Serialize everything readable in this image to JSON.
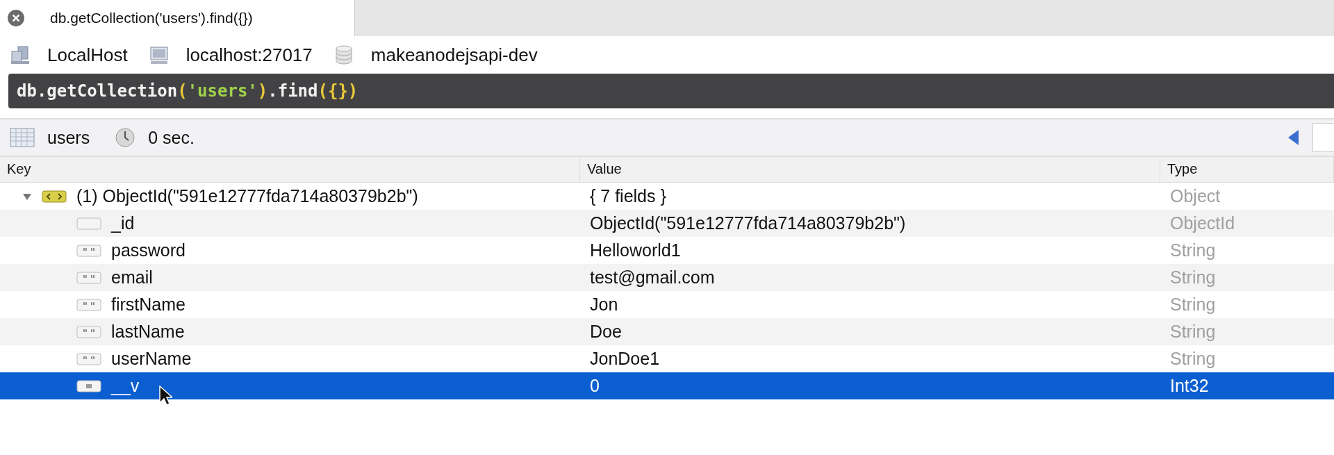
{
  "tab": {
    "title": "db.getCollection('users').find({})",
    "selected": true
  },
  "breadcrumb": [
    {
      "kind": "server",
      "label": "LocalHost"
    },
    {
      "kind": "host",
      "label": "localhost:27017"
    },
    {
      "kind": "database",
      "label": "makeanodejsapi-dev"
    }
  ],
  "query": [
    {
      "kind": "plain",
      "text": "db.getCollection"
    },
    {
      "kind": "paren",
      "text": "("
    },
    {
      "kind": "string",
      "text": "'users'"
    },
    {
      "kind": "paren",
      "text": ")"
    },
    {
      "kind": "plain",
      "text": ".find"
    },
    {
      "kind": "paren",
      "text": "({})"
    }
  ],
  "status": {
    "collection": "users",
    "time": "0 sec."
  },
  "table": {
    "columns": [
      "Key",
      "Value",
      "Type"
    ],
    "rows": [
      {
        "kind": "object",
        "key": "(1) ObjectId(\"591e12777fda714a80379b2b\")",
        "value": "{ 7 fields }",
        "type": "Object",
        "expanded": true,
        "selected": false,
        "children": [
          {
            "kind": "objectid",
            "key": "_id",
            "value": "ObjectId(\"591e12777fda714a80379b2b\")",
            "type": "ObjectId",
            "selected": false
          },
          {
            "kind": "string",
            "key": "password",
            "value": "Helloworld1",
            "type": "String",
            "selected": false
          },
          {
            "kind": "string",
            "key": "email",
            "value": "test@gmail.com",
            "type": "String",
            "selected": false
          },
          {
            "kind": "string",
            "key": "firstName",
            "value": "Jon",
            "type": "String",
            "selected": false
          },
          {
            "kind": "string",
            "key": "lastName",
            "value": "Doe",
            "type": "String",
            "selected": false
          },
          {
            "kind": "string",
            "key": "userName",
            "value": "JonDoe1",
            "type": "String",
            "selected": false
          },
          {
            "kind": "int",
            "key": "__v",
            "value": "0",
            "type": "Int32",
            "selected": true
          }
        ]
      }
    ]
  }
}
